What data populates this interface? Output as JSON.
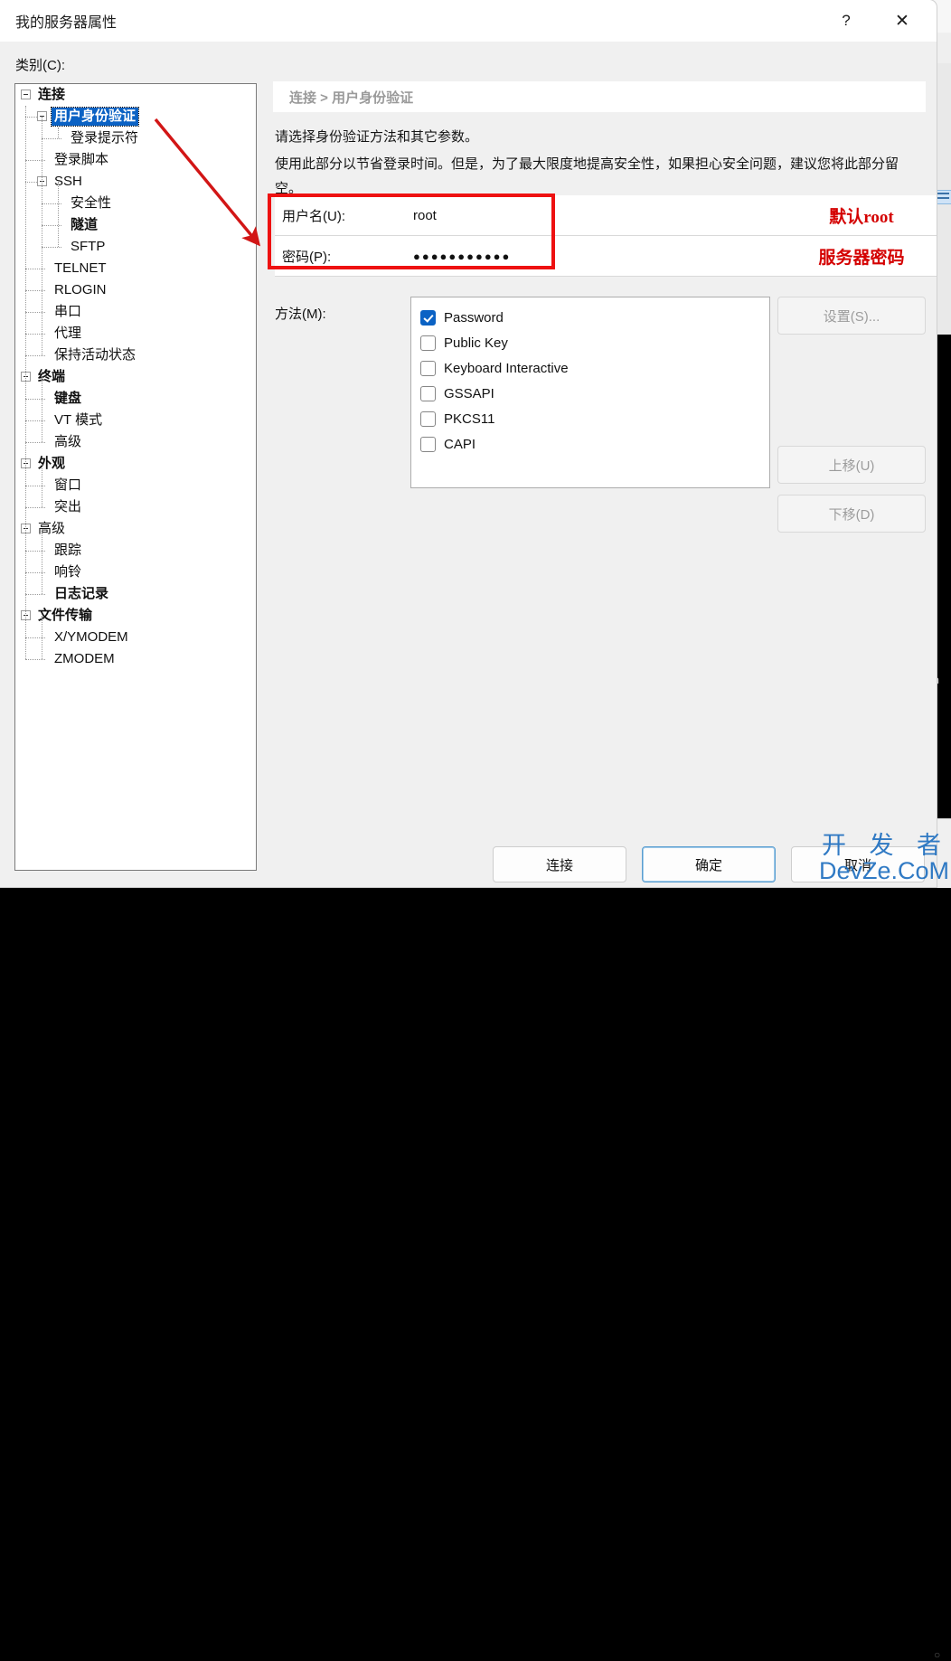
{
  "window": {
    "title": "我的服务器属性",
    "help_icon": "?",
    "close_icon": "✕"
  },
  "category": {
    "label": "类别(C):",
    "tree": [
      {
        "label": "连接",
        "level": 0,
        "bold": true,
        "expander": true,
        "selected": false
      },
      {
        "label": "用户身份验证",
        "level": 1,
        "bold": true,
        "expander": true,
        "selected": true
      },
      {
        "label": "登录提示符",
        "level": 2,
        "bold": false,
        "expander": false,
        "selected": false
      },
      {
        "label": "登录脚本",
        "level": 1,
        "bold": false,
        "expander": false,
        "selected": false
      },
      {
        "label": "SSH",
        "level": 1,
        "bold": false,
        "expander": true,
        "selected": false
      },
      {
        "label": "安全性",
        "level": 2,
        "bold": false,
        "expander": false,
        "selected": false
      },
      {
        "label": "隧道",
        "level": 2,
        "bold": true,
        "expander": false,
        "selected": false
      },
      {
        "label": "SFTP",
        "level": 2,
        "bold": false,
        "expander": false,
        "selected": false
      },
      {
        "label": "TELNET",
        "level": 1,
        "bold": false,
        "expander": false,
        "selected": false
      },
      {
        "label": "RLOGIN",
        "level": 1,
        "bold": false,
        "expander": false,
        "selected": false
      },
      {
        "label": "串口",
        "level": 1,
        "bold": false,
        "expander": false,
        "selected": false
      },
      {
        "label": "代理",
        "level": 1,
        "bold": false,
        "expander": false,
        "selected": false
      },
      {
        "label": "保持活动状态",
        "level": 1,
        "bold": false,
        "expander": false,
        "selected": false
      },
      {
        "label": "终端",
        "level": 0,
        "bold": true,
        "expander": true,
        "selected": false
      },
      {
        "label": "键盘",
        "level": 1,
        "bold": true,
        "expander": false,
        "selected": false
      },
      {
        "label": "VT 模式",
        "level": 1,
        "bold": false,
        "expander": false,
        "selected": false
      },
      {
        "label": "高级",
        "level": 1,
        "bold": false,
        "expander": false,
        "selected": false
      },
      {
        "label": "外观",
        "level": 0,
        "bold": true,
        "expander": true,
        "selected": false
      },
      {
        "label": "窗口",
        "level": 1,
        "bold": false,
        "expander": false,
        "selected": false
      },
      {
        "label": "突出",
        "level": 1,
        "bold": false,
        "expander": false,
        "selected": false
      },
      {
        "label": "高级",
        "level": 0,
        "bold": false,
        "expander": true,
        "selected": false
      },
      {
        "label": "跟踪",
        "level": 1,
        "bold": false,
        "expander": false,
        "selected": false
      },
      {
        "label": "响铃",
        "level": 1,
        "bold": false,
        "expander": false,
        "selected": false
      },
      {
        "label": "日志记录",
        "level": 1,
        "bold": true,
        "expander": false,
        "selected": false
      },
      {
        "label": "文件传输",
        "level": 0,
        "bold": true,
        "expander": true,
        "selected": false
      },
      {
        "label": "X/YMODEM",
        "level": 1,
        "bold": false,
        "expander": false,
        "selected": false
      },
      {
        "label": "ZMODEM",
        "level": 1,
        "bold": false,
        "expander": false,
        "selected": false
      }
    ]
  },
  "content": {
    "breadcrumb": "连接 > 用户身份验证",
    "description_line1": "请选择身份验证方法和其它参数。",
    "description_line2": "使用此部分以节省登录时间。但是，为了最大限度地提高安全性，如果担心安全问题，建议您将此部分留空。",
    "fields": [
      {
        "label": "用户名(U):",
        "value": "root",
        "masked": false,
        "annotation": "默认root"
      },
      {
        "label": "密码(P):",
        "value": "●●●●●●●●●●●",
        "masked": true,
        "annotation": "服务器密码"
      }
    ],
    "methods_label": "方法(M):",
    "methods": [
      {
        "label": "Password",
        "checked": true
      },
      {
        "label": "Public Key",
        "checked": false
      },
      {
        "label": "Keyboard Interactive",
        "checked": false
      },
      {
        "label": "GSSAPI",
        "checked": false
      },
      {
        "label": "PKCS11",
        "checked": false
      },
      {
        "label": "CAPI",
        "checked": false
      }
    ],
    "side_buttons": [
      {
        "label": "设置(S)...",
        "disabled": true
      },
      {
        "label": "上移(U)",
        "disabled": true
      },
      {
        "label": "下移(D)",
        "disabled": true
      }
    ]
  },
  "footer": {
    "connect": "连接",
    "ok": "确定",
    "cancel": "取消"
  },
  "annotation_color": "#ee1111",
  "accent_color": "#0b62c4",
  "watermark": {
    "line1": "开 发 者",
    "line2": "DevZe.CoM"
  },
  "background_app": {
    "terminal_text": "n"
  }
}
